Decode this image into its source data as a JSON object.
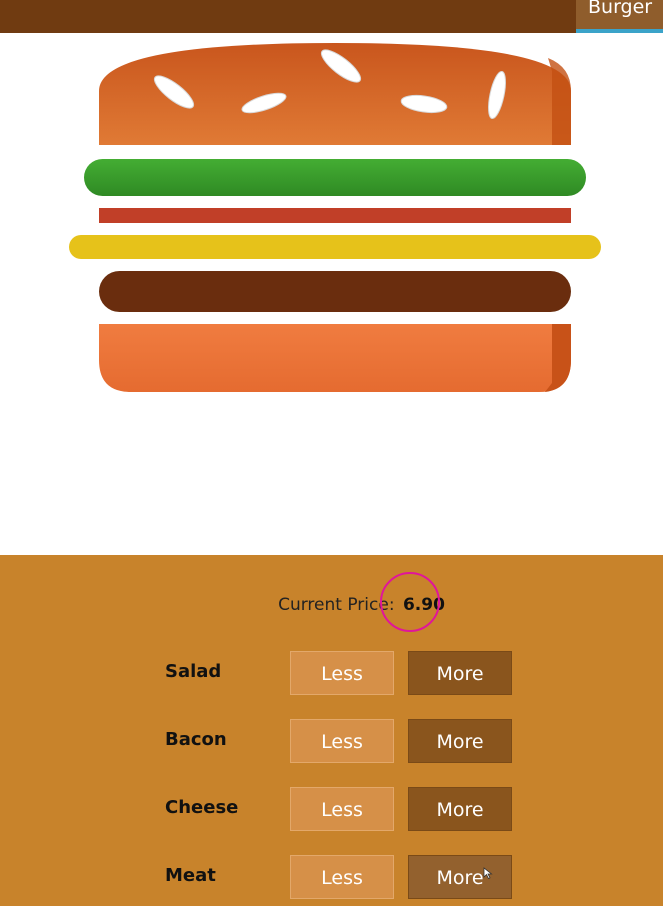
{
  "nav": {
    "tab_label": "Burger"
  },
  "burger": {
    "colors": {
      "bun": "#d8692c",
      "bun_shadow": "#c55215",
      "sesame": "#ffffff",
      "salad": "#3fa630",
      "bacon": "#c0402a",
      "cheese": "#e6c21c",
      "meat": "#6a2e0e",
      "bottom_bun": "#ef7a3e"
    }
  },
  "price": {
    "label": "Current Price:",
    "value": "6.90"
  },
  "ingredients": [
    {
      "name": "Salad",
      "less": "Less",
      "more": "More"
    },
    {
      "name": "Bacon",
      "less": "Less",
      "more": "More"
    },
    {
      "name": "Cheese",
      "less": "Less",
      "more": "More"
    },
    {
      "name": "Meat",
      "less": "Less",
      "more": "More"
    }
  ]
}
